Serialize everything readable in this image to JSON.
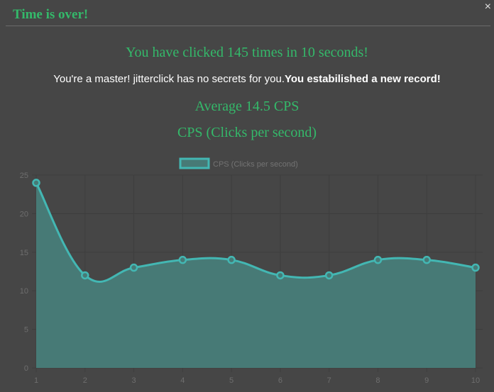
{
  "dialog": {
    "title": "Time is over!",
    "close_symbol": "×"
  },
  "result": {
    "clicks_line": "You have clicked 145 times in 10 seconds!",
    "message": "You're a master! jitterclick has no secrets for you.",
    "record": "You estabilished a new record!",
    "average": "Average 14.5 CPS",
    "chart_heading": "CPS (Clicks per second)"
  },
  "chart_data": {
    "type": "area",
    "title": "",
    "xlabel": "",
    "ylabel": "",
    "x": [
      1,
      2,
      3,
      4,
      5,
      6,
      7,
      8,
      9,
      10
    ],
    "series": [
      {
        "name": "CPS (Clicks per second)",
        "values": [
          24,
          12,
          13,
          14,
          14,
          12,
          12,
          14,
          14,
          13
        ]
      }
    ],
    "ylim": [
      0,
      25
    ],
    "yticks": [
      0,
      5,
      10,
      15,
      20,
      25
    ],
    "grid": true,
    "legend": "top-center",
    "colors": {
      "line": "#43b7b3",
      "fill": "#477a76",
      "grid": "#3e3e3e"
    }
  }
}
